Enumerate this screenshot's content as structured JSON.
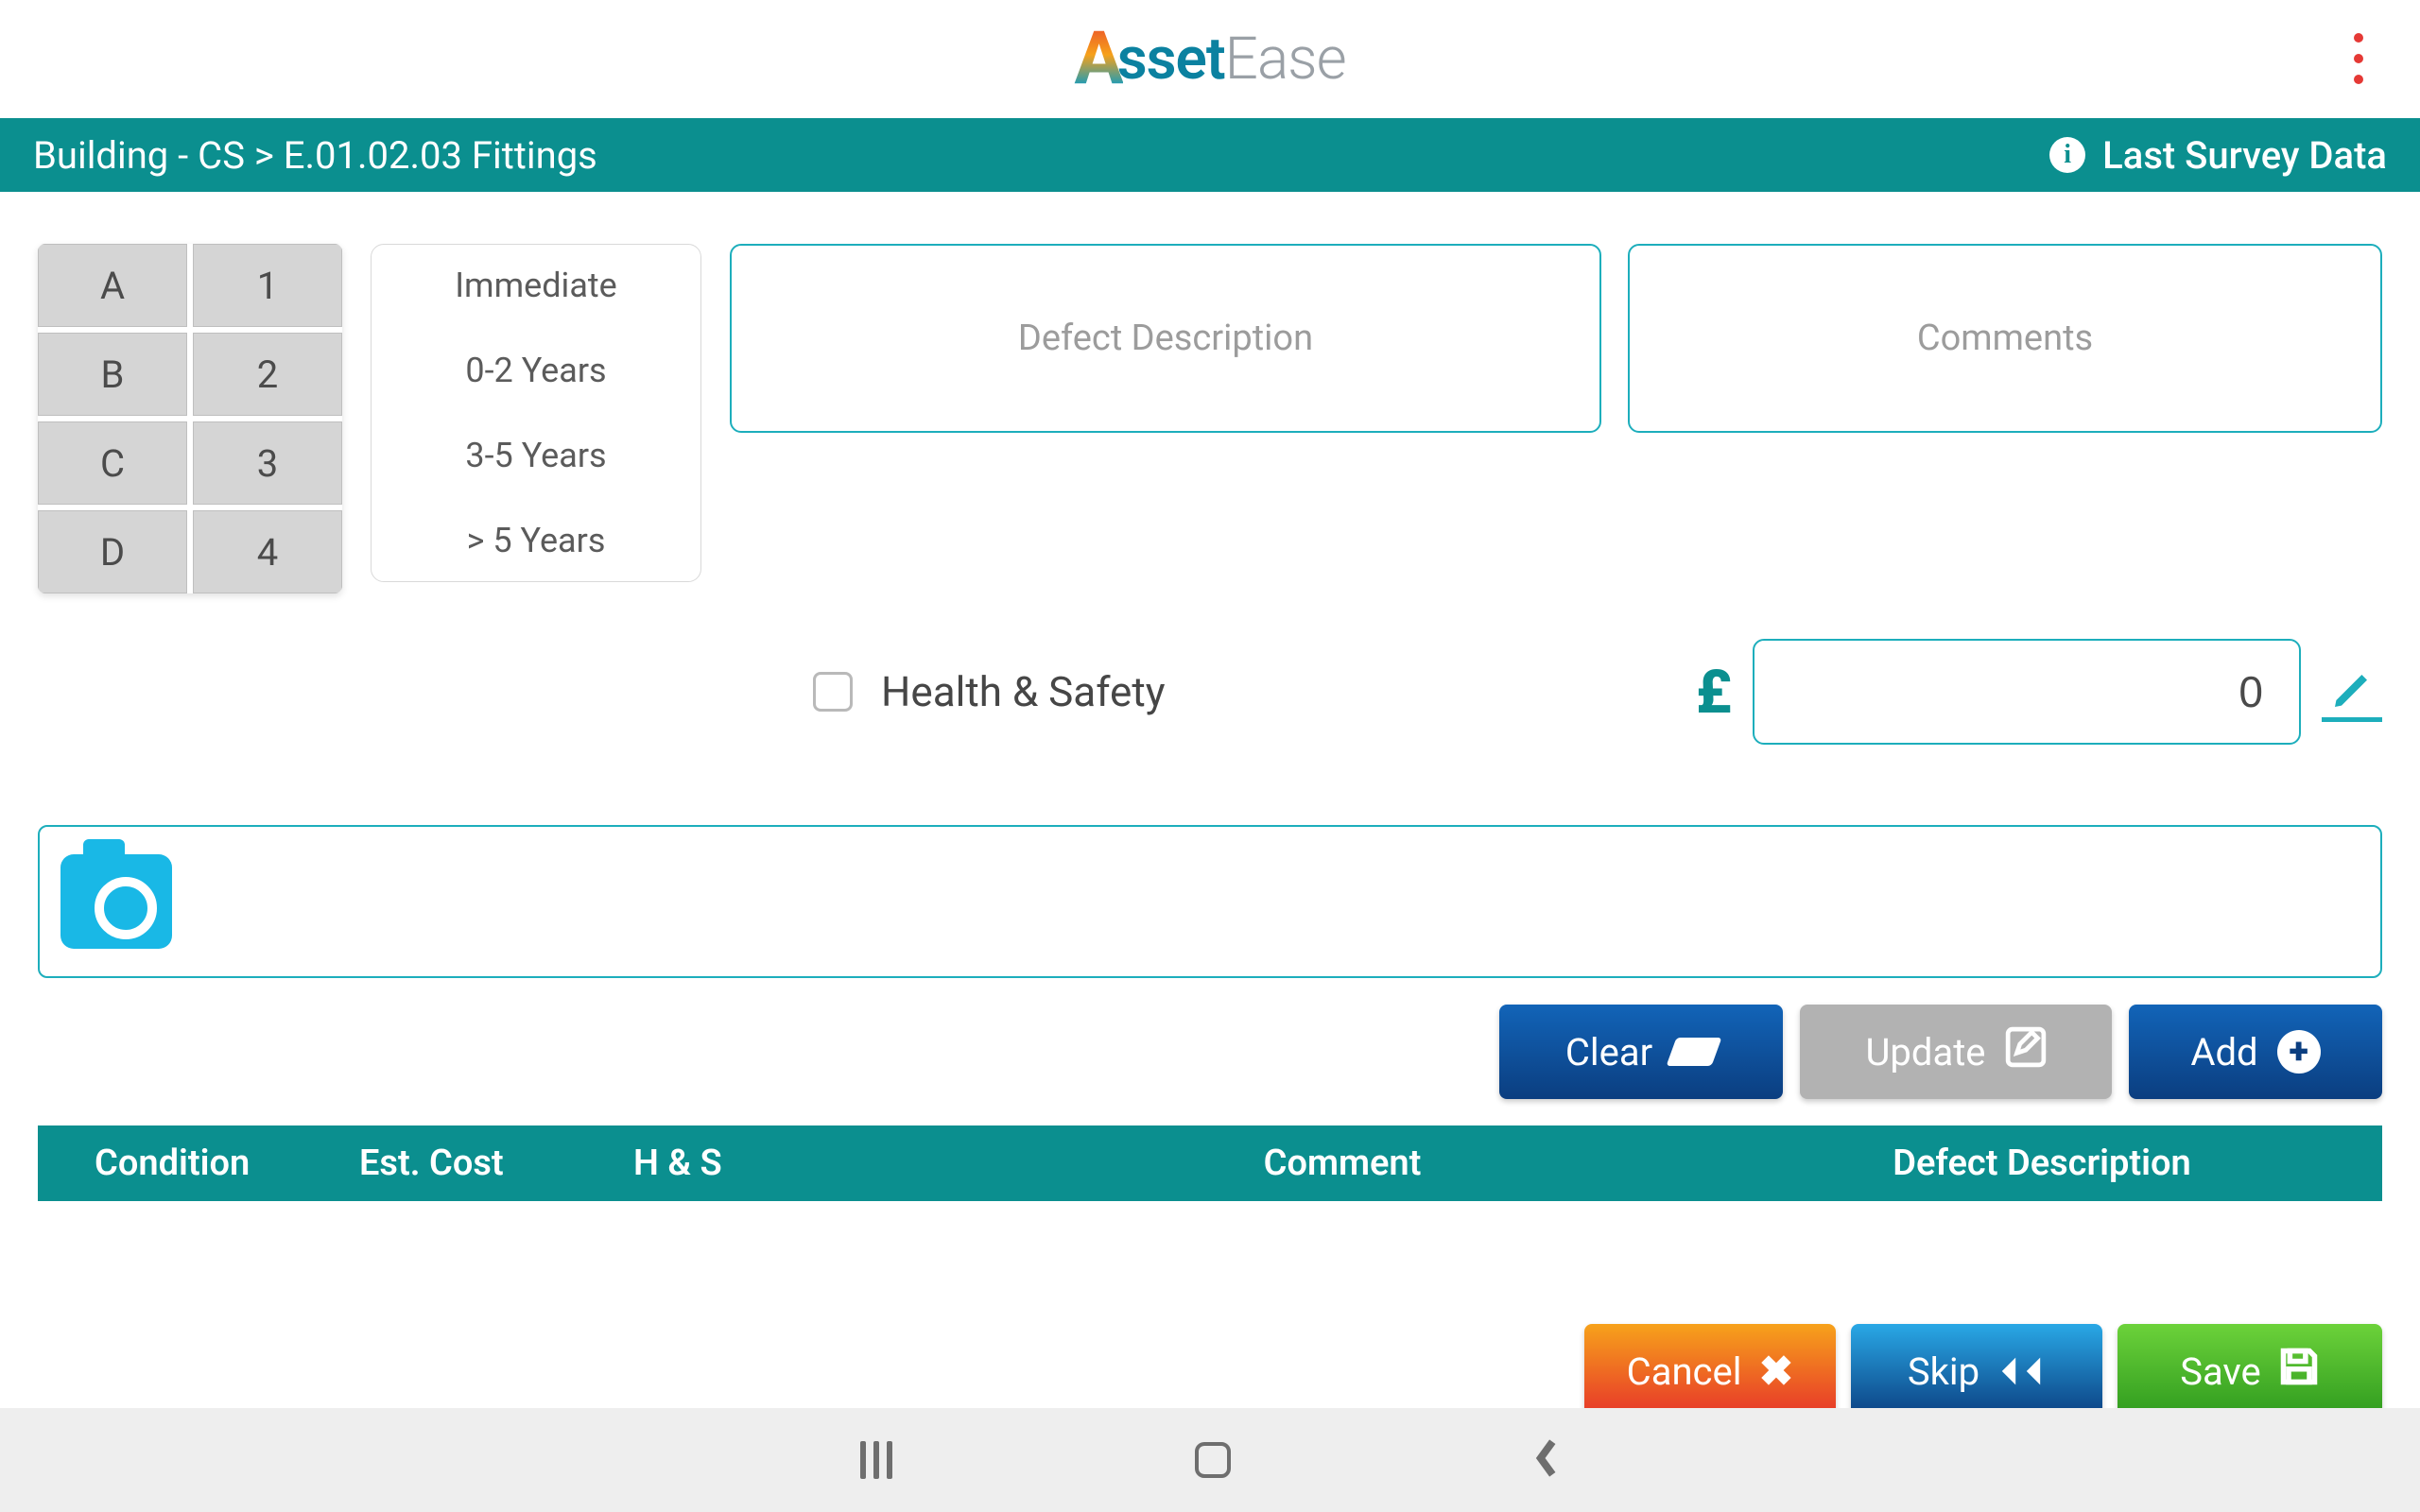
{
  "app": {
    "logo_left": "A",
    "logo_mid": "sset",
    "logo_right": "Ease"
  },
  "breadcrumb": {
    "path": "Building - CS  > E.01.02.03 Fittings",
    "last_survey": "Last Survey Data"
  },
  "grades": {
    "letters": [
      "A",
      "B",
      "C",
      "D"
    ],
    "numbers": [
      "1",
      "2",
      "3",
      "4"
    ]
  },
  "timescales": [
    "Immediate",
    "0-2 Years",
    "3-5 Years",
    "> 5 Years"
  ],
  "inputs": {
    "defect_placeholder": "Defect Description",
    "comments_placeholder": "Comments",
    "hs_label": "Health & Safety",
    "currency": "£",
    "cost_value": "0"
  },
  "buttons": {
    "clear": "Clear",
    "update": "Update",
    "add": "Add",
    "cancel": "Cancel",
    "skip": "Skip",
    "save": "Save"
  },
  "table": {
    "headers": {
      "condition": "Condition",
      "cost": "Est. Cost",
      "hs": "H & S",
      "comment": "Comment",
      "defect": "Defect Description"
    }
  }
}
